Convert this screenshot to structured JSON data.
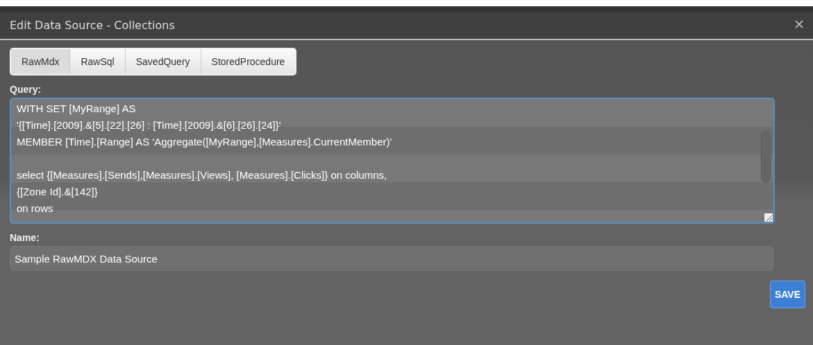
{
  "window": {
    "title": "Edit Data Source - Collections"
  },
  "tabs": [
    {
      "label": "RawMdx",
      "selected": true
    },
    {
      "label": "RawSql",
      "selected": false
    },
    {
      "label": "SavedQuery",
      "selected": false
    },
    {
      "label": "StoredProcedure",
      "selected": false
    }
  ],
  "query": {
    "label": "Query:",
    "value": "WITH SET [MyRange] AS\n'{[Time].[2009].&[5].[22].[26] : [Time].[2009].&[6].[26].[24]}'\nMEMBER [Time].[Range] AS 'Aggregate([MyRange],[Measures].CurrentMember)'\n\nselect {[Measures].[Sends],[Measures].[Views], [Measures].[Clicks]} on columns,\n{[Zone Id].&[142]}\non rows"
  },
  "name": {
    "label": "Name:",
    "value": "Sample RawMDX Data Source"
  },
  "buttons": [
    {
      "label": "SAVE"
    }
  ]
}
